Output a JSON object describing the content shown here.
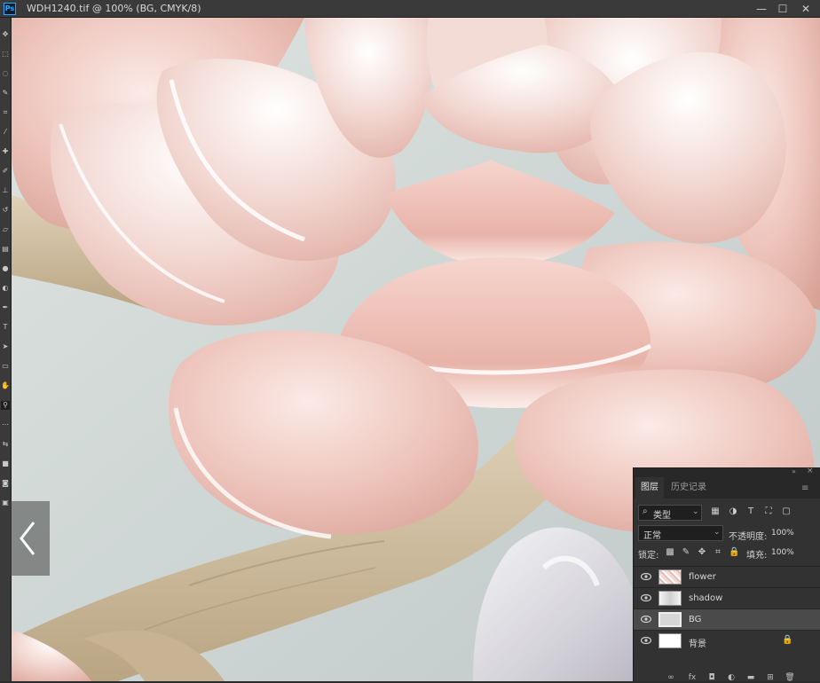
{
  "window": {
    "app_icon_label": "Ps",
    "title": "WDH1240.tif @ 100% (BG, CMYK/8)",
    "min_label": "—",
    "max_label": "☐",
    "close_label": "✕"
  },
  "toolbar": {
    "tools": [
      {
        "icon": "move-icon",
        "glyph": "✥"
      },
      {
        "icon": "marquee-icon",
        "glyph": "⬚"
      },
      {
        "icon": "lasso-icon",
        "glyph": "◌"
      },
      {
        "icon": "quick-select-icon",
        "glyph": "✎"
      },
      {
        "icon": "crop-icon",
        "glyph": "⌗"
      },
      {
        "icon": "eyedropper-icon",
        "glyph": "⁄"
      },
      {
        "icon": "healing-icon",
        "glyph": "✚"
      },
      {
        "icon": "brush-icon",
        "glyph": "✐"
      },
      {
        "icon": "clone-stamp-icon",
        "glyph": "⊥"
      },
      {
        "icon": "history-brush-icon",
        "glyph": "↺"
      },
      {
        "icon": "eraser-icon",
        "glyph": "▱"
      },
      {
        "icon": "gradient-icon",
        "glyph": "▤"
      },
      {
        "icon": "blur-icon",
        "glyph": "●"
      },
      {
        "icon": "dodge-icon",
        "glyph": "◐"
      },
      {
        "icon": "pen-icon",
        "glyph": "✒"
      },
      {
        "icon": "type-icon",
        "glyph": "T"
      },
      {
        "icon": "path-select-icon",
        "glyph": "➤"
      },
      {
        "icon": "shape-icon",
        "glyph": "▭"
      },
      {
        "icon": "hand-icon",
        "glyph": "✋"
      },
      {
        "icon": "zoom-icon",
        "glyph": "⚲"
      },
      {
        "icon": "more-tools-icon",
        "glyph": "⋯"
      },
      {
        "icon": "swap-colors-icon",
        "glyph": "⇆"
      },
      {
        "icon": "color-swatch-icon",
        "glyph": "■"
      },
      {
        "icon": "quick-mask-icon",
        "glyph": "◙"
      },
      {
        "icon": "screen-mode-icon",
        "glyph": "▣"
      }
    ]
  },
  "layers_panel": {
    "tabs": [
      {
        "label": "图层"
      },
      {
        "label": "历史记录"
      }
    ],
    "filter": {
      "search_glyph": "⌕",
      "kind_label": "类型",
      "chevron": "⌄",
      "icons": [
        {
          "name": "filter-pixel-icon",
          "glyph": "▦"
        },
        {
          "name": "filter-adjustment-icon",
          "glyph": "◑"
        },
        {
          "name": "filter-type-icon",
          "glyph": "T"
        },
        {
          "name": "filter-shape-icon",
          "glyph": "⛶"
        },
        {
          "name": "filter-smart-object-icon",
          "glyph": "▢"
        }
      ]
    },
    "blend_mode": "正常",
    "opacity_label": "不透明度:",
    "opacity_value": "100%",
    "lock_label": "锁定:",
    "lock_icons": [
      {
        "name": "lock-transparent-icon",
        "glyph": "▩"
      },
      {
        "name": "lock-image-icon",
        "glyph": "✎"
      },
      {
        "name": "lock-position-icon",
        "glyph": "✥"
      },
      {
        "name": "lock-artboard-icon",
        "glyph": "⌗"
      },
      {
        "name": "lock-all-icon",
        "glyph": "🔒"
      }
    ],
    "fill_label": "填充:",
    "fill_value": "100%",
    "layers": [
      {
        "name": "flower",
        "thumb": "flower",
        "selected": false,
        "locked": false
      },
      {
        "name": "shadow",
        "thumb": "shadow",
        "selected": false,
        "locked": false
      },
      {
        "name": "BG",
        "thumb": "bg",
        "selected": true,
        "locked": false
      },
      {
        "name": "背景",
        "thumb": "white",
        "selected": false,
        "locked": true
      }
    ],
    "footer_icons": [
      {
        "name": "link-layers-icon",
        "glyph": "∞"
      },
      {
        "name": "layer-style-icon",
        "glyph": "fx"
      },
      {
        "name": "add-mask-icon",
        "glyph": "◘"
      },
      {
        "name": "new-adjustment-icon",
        "glyph": "◐"
      },
      {
        "name": "new-group-icon",
        "glyph": "▬"
      },
      {
        "name": "new-layer-icon",
        "glyph": "⊞"
      },
      {
        "name": "delete-layer-icon",
        "glyph": "🗑"
      }
    ]
  },
  "nav": {
    "prev_icon": "chevron-left-icon",
    "next_icon": "chevron-right-icon"
  }
}
